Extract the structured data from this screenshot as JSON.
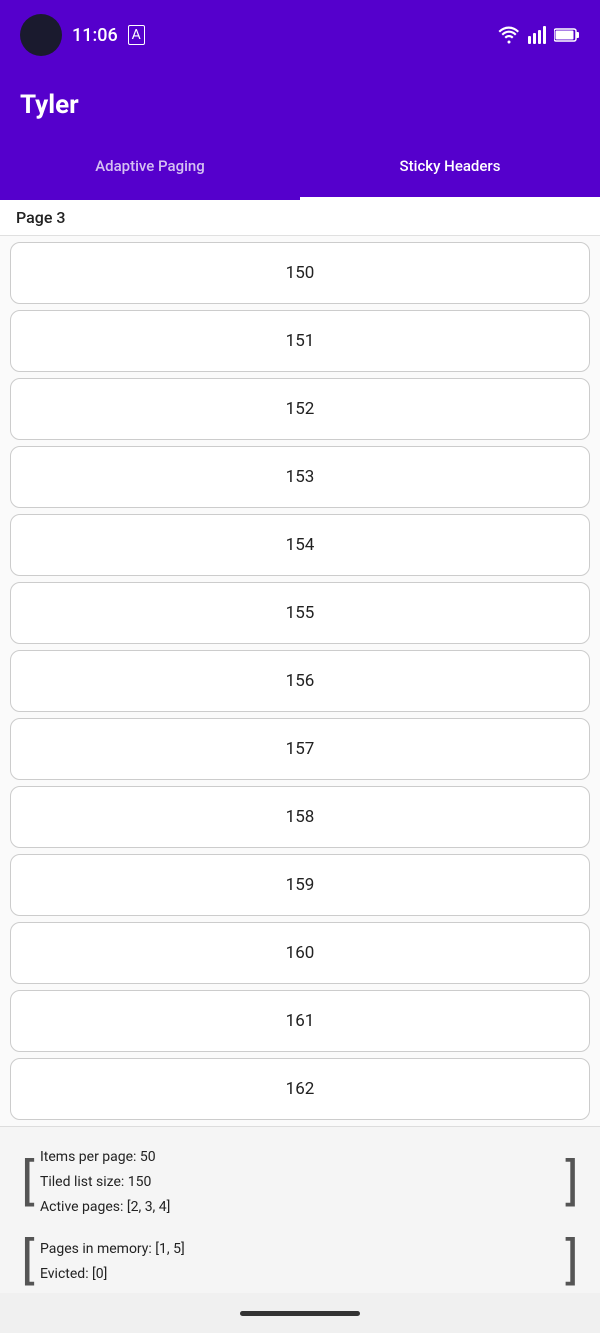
{
  "statusBar": {
    "time": "11:06",
    "indicator": "A"
  },
  "appBar": {
    "title": "Tyler"
  },
  "tabs": [
    {
      "label": "Adaptive Paging",
      "active": false
    },
    {
      "label": "Sticky Headers",
      "active": true
    }
  ],
  "stickyHeader": {
    "label": "Page 3"
  },
  "listItems": [
    150,
    151,
    152,
    153,
    154,
    155,
    156,
    157,
    158,
    159,
    160,
    161,
    162
  ],
  "footerInfo": {
    "itemsPerPage": "Items per page: 50",
    "tiledListSize": "Tiled list size: 150",
    "activePages": "Active pages: [2, 3, 4]",
    "pagesInMemory": "Pages in memory: [1, 5]",
    "evicted": "Evicted: [0]"
  }
}
